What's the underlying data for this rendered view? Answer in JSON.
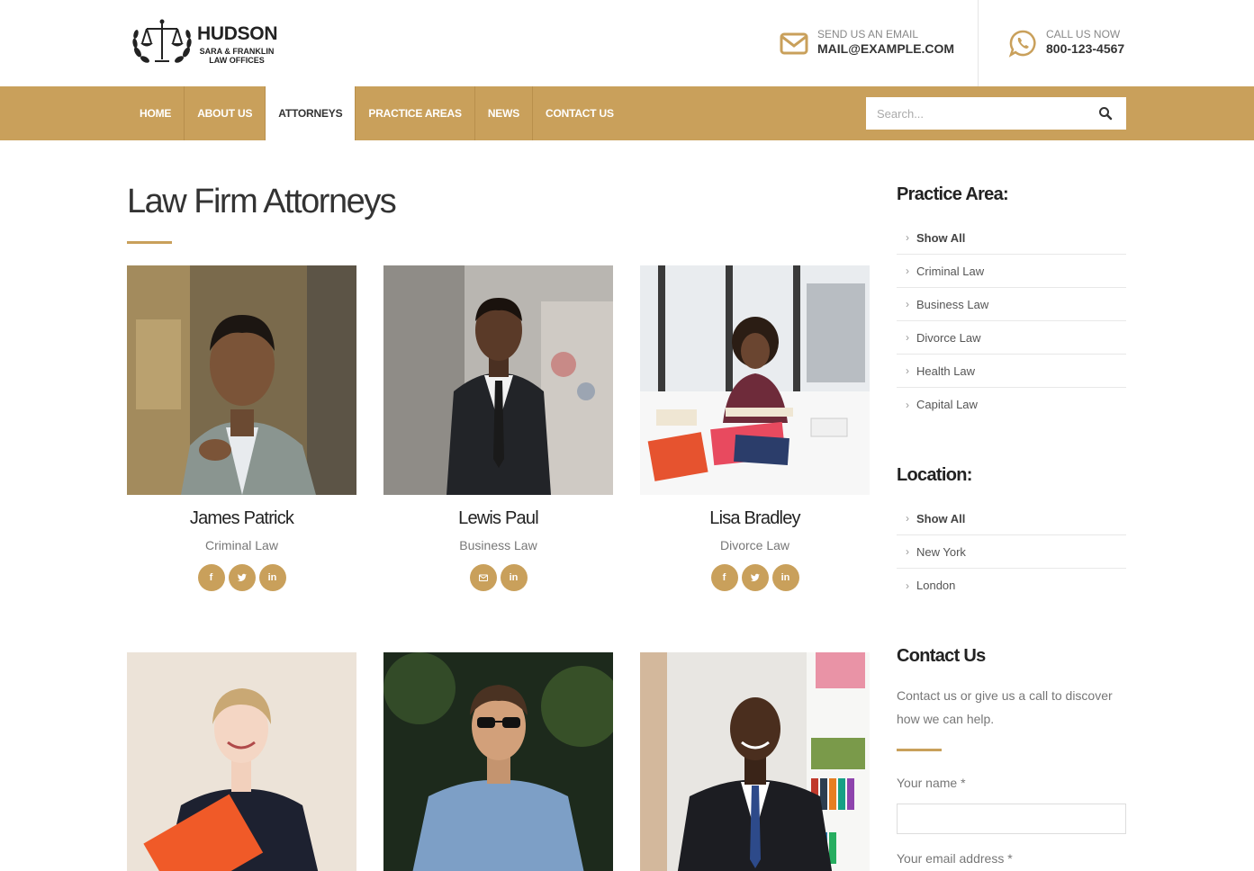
{
  "header": {
    "logo": {
      "name": "HUDSON",
      "sub_line1": "SARA & FRANKLIN",
      "sub_line2": "LAW OFFICES"
    },
    "email": {
      "label": "SEND US AN EMAIL",
      "value": "MAIL@EXAMPLE.COM",
      "icon": "envelope-icon"
    },
    "phone": {
      "label": "CALL US NOW",
      "value": "800-123-4567",
      "icon": "whatsapp-icon"
    }
  },
  "nav": {
    "items": [
      {
        "label": "HOME"
      },
      {
        "label": "ABOUT US"
      },
      {
        "label": "ATTORNEYS"
      },
      {
        "label": "PRACTICE AREAS"
      },
      {
        "label": "NEWS"
      },
      {
        "label": "CONTACT US"
      }
    ],
    "active": "ATTORNEYS",
    "search_placeholder": "Search..."
  },
  "main": {
    "title": "Law Firm Attorneys",
    "attorneys": [
      {
        "name": "James Patrick",
        "role": "Criminal Law",
        "socials": [
          "facebook",
          "twitter",
          "linkedin"
        ]
      },
      {
        "name": "Lewis Paul",
        "role": "Business Law",
        "socials": [
          "email",
          "linkedin"
        ]
      },
      {
        "name": "Lisa Bradley",
        "role": "Divorce Law",
        "socials": [
          "facebook",
          "twitter",
          "linkedin"
        ]
      },
      {
        "name": "",
        "role": "",
        "socials": []
      },
      {
        "name": "",
        "role": "",
        "socials": []
      },
      {
        "name": "",
        "role": "",
        "socials": []
      }
    ]
  },
  "sidebar": {
    "practice_title": "Practice Area:",
    "practice_items": [
      "Show All",
      "Criminal Law",
      "Business Law",
      "Divorce Law",
      "Health Law",
      "Capital Law"
    ],
    "location_title": "Location:",
    "location_items": [
      "Show All",
      "New York",
      "London"
    ],
    "contact_title": "Contact Us",
    "contact_text": "Contact us or give us a call to discover how we can help.",
    "name_label": "Your name *",
    "email_label": "Your email address *"
  },
  "colors": {
    "accent": "#c9a05b",
    "heading": "#222222",
    "text": "#777777"
  }
}
